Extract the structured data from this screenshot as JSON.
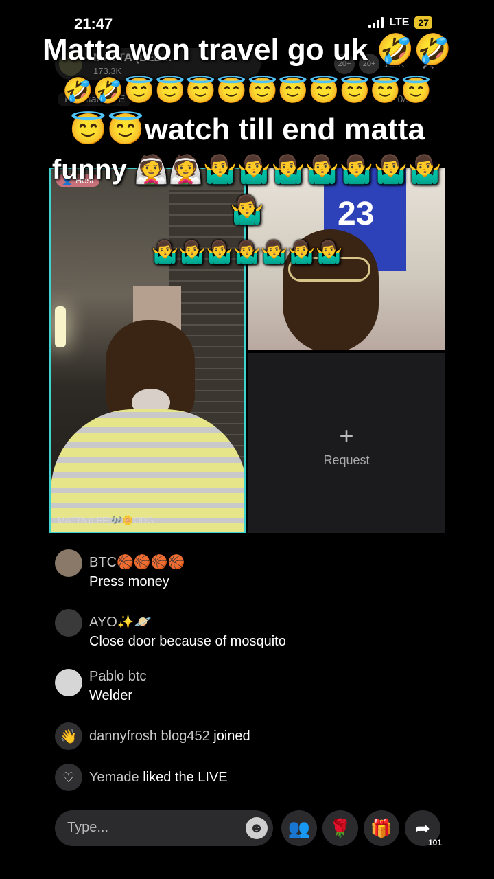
{
  "status_bar": {
    "time": "21:47",
    "network": "LTE",
    "battery": "27"
  },
  "live_header": {
    "host_name": "MATTA (LEE...",
    "host_likes": "173.3K",
    "popular_label": "Popular LIVE",
    "viewer_count": "1.3K",
    "viewer_avatar_labels": [
      "20+",
      "20+"
    ],
    "guest_count": "0/5"
  },
  "caption": {
    "line1": "Matta won travel go uk 🤣🤣",
    "line2": "🤣🤣😇😇😇😇😇😇😇😇😇😇",
    "line3": "😇😇watch till end matta",
    "line4": "funny 👰👰🤷‍♂️🤷‍♂️🤷‍♂️🤷‍♂️🤷‍♂️🤷‍♂️🤷‍♂️🤷‍♂️",
    "line5": "🤷‍♂️🤷‍♂️🤷‍♂️🤷‍♂️🤷‍♂️🤷‍♂️🤷‍♂️"
  },
  "host_video": {
    "badge": "Host",
    "tag": "MATTA (LEE)🎶🌼ODG"
  },
  "guest_video": {
    "jersey_text": "23"
  },
  "request_slot": {
    "icon": "+",
    "label": "Request"
  },
  "chat_messages": [
    {
      "user": "BTC🏀🏀🏀🏀",
      "text": "Press money",
      "avatar_color": "#8a7968"
    },
    {
      "user": "AYO✨🪐",
      "text": "Close door because of mosquito",
      "avatar_color": "#3a3a3a"
    },
    {
      "user": "Pablo btc",
      "text": "Welder",
      "avatar_color": "#d6d6d6"
    }
  ],
  "system_events": [
    {
      "user": "dannyfrosh blog452",
      "action": " joined",
      "icon": "wave-icon",
      "glyph": "👋"
    },
    {
      "user": "Yemade",
      "action": " liked the LIVE",
      "icon": "heart-icon",
      "glyph": "♡"
    }
  ],
  "bottom_bar": {
    "placeholder": "Type...",
    "share_count": "101",
    "icons": {
      "emoji": "☻",
      "guests": "👥",
      "rose": "🌹",
      "gift": "🎁",
      "share": "➦"
    }
  },
  "colors": {
    "host_border": "#3fd3d0",
    "battery": "#e9c32c",
    "host_badge": "#c9717a"
  }
}
